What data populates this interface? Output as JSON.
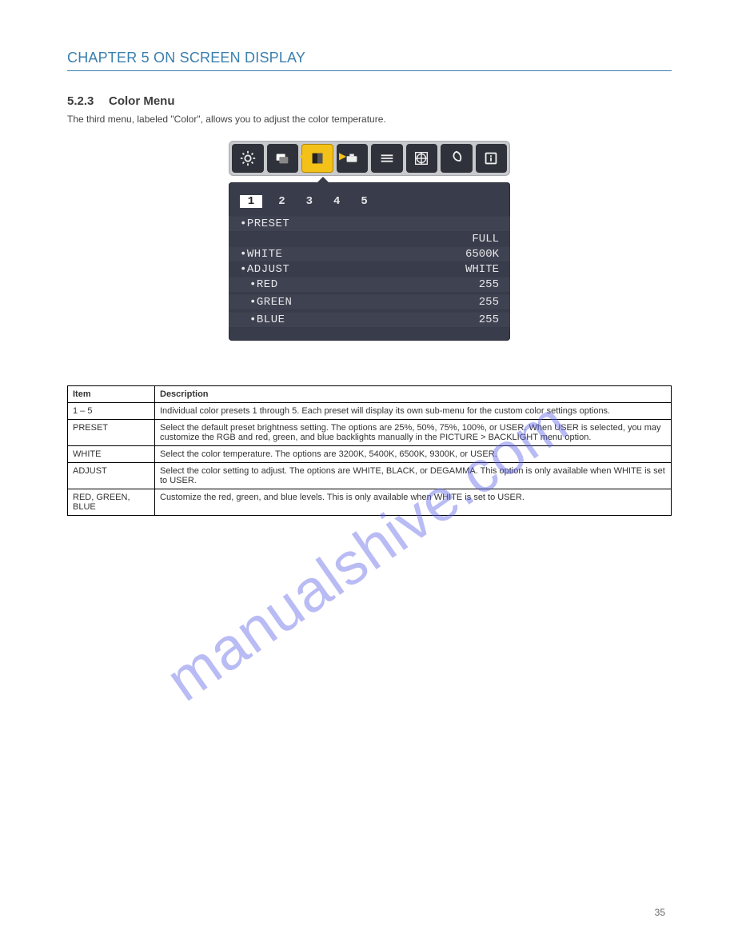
{
  "header": {
    "text": "CHAPTER 5 ON SCREEN DISPLAY"
  },
  "section": {
    "number": "5.2.3",
    "title": "Color Menu",
    "desc": "The third menu, labeled \"Color\", allows you to adjust the color temperature."
  },
  "osd": {
    "tabs": [
      "1",
      "2",
      "3",
      "4",
      "5"
    ],
    "active_tab_index": 0,
    "rows": {
      "preset": {
        "label": "PRESET",
        "value": "FULL"
      },
      "white": {
        "label": "WHITE",
        "value": "6500K"
      },
      "adjust": {
        "label": "ADJUST",
        "value": "WHITE"
      },
      "red": {
        "label": "RED",
        "value": "255"
      },
      "green": {
        "label": "GREEN",
        "value": "255"
      },
      "blue": {
        "label": "BLUE",
        "value": "255"
      }
    },
    "icons": [
      "brightness-icon",
      "picture-icon",
      "color-icon",
      "tools-icon",
      "option-icon",
      "geometry-icon",
      "eco-icon",
      "info-icon"
    ]
  },
  "table": {
    "head": {
      "item": "Item",
      "desc": "Description"
    },
    "rows": {
      "one_to_five": {
        "item": "1 – 5",
        "desc": "Individual color presets 1 through 5. Each preset will display its own sub-menu for the custom color settings options."
      },
      "preset": {
        "item": "PRESET",
        "desc": "Select the default preset brightness setting. The options are 25%, 50%, 75%, 100%, or USER. When USER is selected, you may customize the RGB and red, green, and blue backlights manually in the PICTURE > BACKLIGHT menu option."
      },
      "white": {
        "item": "WHITE",
        "desc": "Select the color temperature. The options are 3200K, 5400K, 6500K, 9300K, or USER."
      },
      "adjust": {
        "item": "ADJUST",
        "desc": "Select the color setting to adjust. The options are WHITE, BLACK, or DEGAMMA. This option is only available when WHITE is set to USER."
      },
      "rgb": {
        "item": "RED, GREEN, BLUE",
        "desc": "Customize the red, green, and blue levels. This is only available when WHITE is set to USER."
      }
    }
  },
  "watermark": "manualshive.com",
  "page_number": "35"
}
